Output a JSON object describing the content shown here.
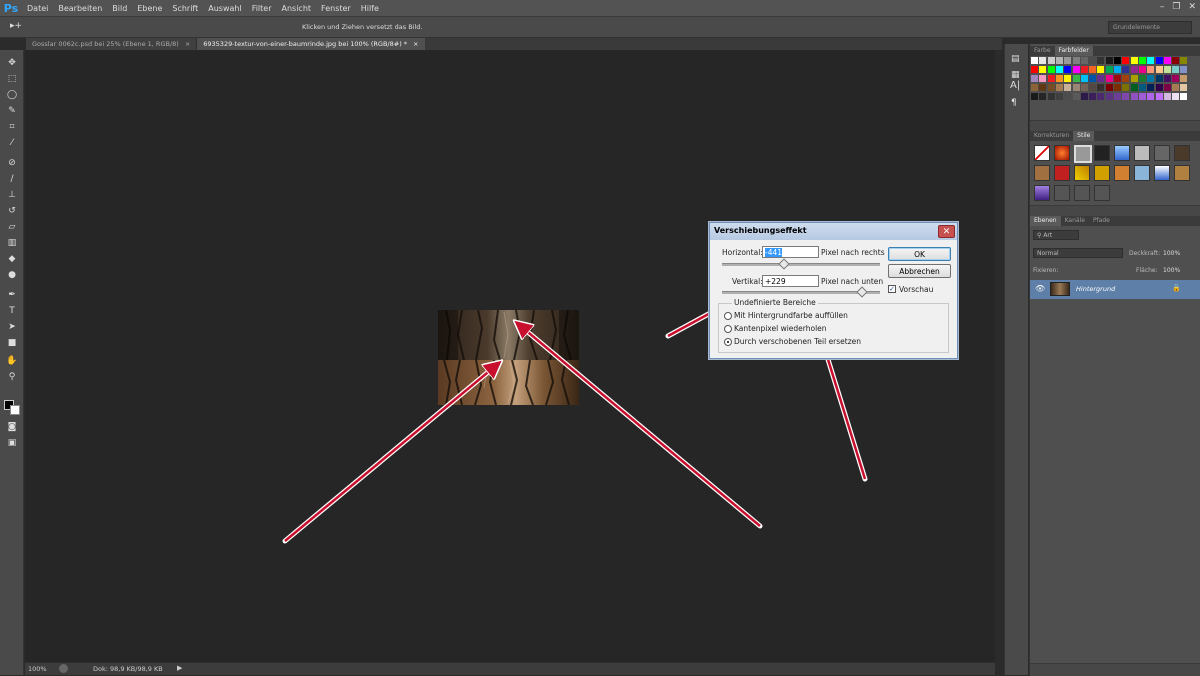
{
  "app": {
    "logo": "Ps"
  },
  "menu": [
    "Datei",
    "Bearbeiten",
    "Bild",
    "Ebene",
    "Schrift",
    "Auswahl",
    "Filter",
    "Ansicht",
    "Fenster",
    "Hilfe"
  ],
  "window_controls": {
    "minimize": "–",
    "restore": "❐",
    "close": "✕"
  },
  "options_bar": {
    "tool_glyph": "▸+",
    "hint": "Klicken und Ziehen versetzt das Bild.",
    "workspace": "Grundelemente"
  },
  "tabs": [
    {
      "label": "Gosslar 0062c.psd bei 25% (Ebene 1, RGB/8)",
      "close": "×"
    },
    {
      "label": "6935329-textur-von-einer-baumrinde.jpg bei 100% (RGB/8#) *",
      "close": "×"
    }
  ],
  "status": {
    "zoom": "100%",
    "doc": "Dok: 98,9 KB/98,9 KB"
  },
  "panels": {
    "swatches_tabs": [
      "Farbe",
      "Farbfelder"
    ],
    "adjust_tabs": [
      "Korrekturen",
      "Stile"
    ],
    "layers_tabs": [
      "Ebenen",
      "Kanäle",
      "Pfade"
    ],
    "layer_filter": "Art",
    "blend_mode": "Normal",
    "opacity_label": "Deckkraft:",
    "opacity_value": "100%",
    "lock_label": "Fixieren:",
    "fill_label": "Fläche:",
    "fill_value": "100%",
    "layer_name": "Hintergrund"
  },
  "dialog": {
    "title": "Verschiebungseffekt",
    "horizontal_label": "Horizontal:",
    "horizontal_value": "-441",
    "horizontal_unit": "Pixel nach rechts",
    "vertical_label": "Vertikal:",
    "vertical_value": "+229",
    "vertical_unit": "Pixel nach unten",
    "ok": "OK",
    "cancel": "Abbrechen",
    "preview": "Vorschau",
    "group_label": "Undefinierte Bereiche",
    "options": [
      "Mit Hintergrundfarbe auffüllen",
      "Kantenpixel wiederholen",
      "Durch verschobenen Teil ersetzen"
    ],
    "selected_option": 2
  },
  "colors": {
    "ui_dark": "#2b2b2b",
    "canvas": "#262626",
    "arrow": "#c8102e",
    "dialog_title": "#b6c9e3"
  }
}
